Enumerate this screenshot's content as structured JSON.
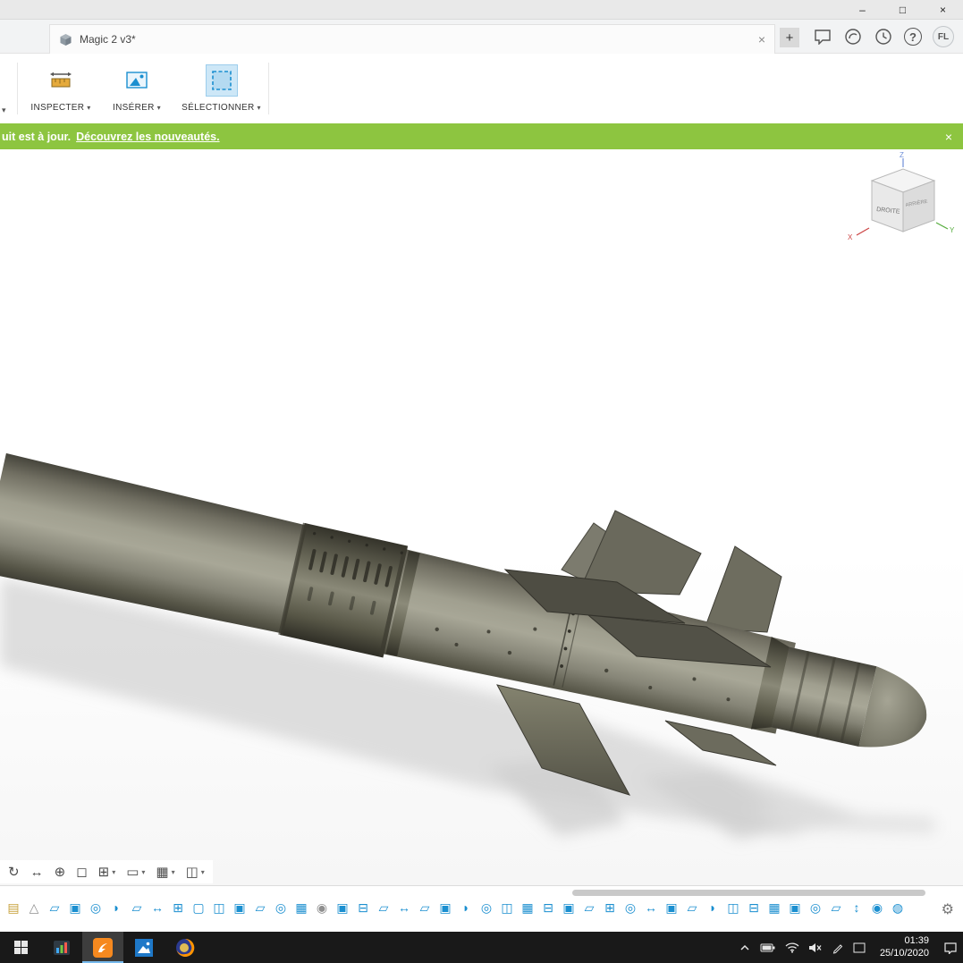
{
  "colors": {
    "accent-blue": "#0696d7",
    "banner-green": "#8dc540",
    "missile-body": "#8b8a7a",
    "timeline-icon-blue": "#1b8fd0",
    "taskbar-bg": "#191919"
  },
  "window": {
    "title_buttons": {
      "minimize": "–",
      "maximize": "□",
      "close": "×"
    }
  },
  "tabbar": {
    "document_tab": {
      "title": "Magic 2 v3*",
      "close_glyph": "×"
    },
    "new_tab_glyph": "+",
    "help_glyph": "?",
    "avatar_initials": "FL"
  },
  "toolbar": {
    "caret": "▾",
    "groups": [
      {
        "label": "INSPECTER",
        "icon": "measure-icon"
      },
      {
        "label": "INSÉRER",
        "icon": "insert-image-icon"
      },
      {
        "label": "SÉLECTIONNER",
        "icon": "select-box-icon",
        "active": true
      }
    ]
  },
  "banner": {
    "message": "uit est à jour.",
    "link_text": "Découvrez les nouveautés.",
    "close_glyph": "×"
  },
  "viewcube": {
    "face_front": "DROITE",
    "face_side": "ARRIÈRE",
    "axis_x": "X",
    "axis_y": "Y",
    "axis_z": "Z"
  },
  "navbar": {
    "items": [
      {
        "name": "orbit-tool",
        "glyph": "↻",
        "caret": false
      },
      {
        "name": "pan-tool",
        "glyph": "↔",
        "caret": false
      },
      {
        "name": "zoom-tool",
        "glyph": "⊕",
        "caret": false
      },
      {
        "name": "fit-view-tool",
        "glyph": "◻",
        "caret": false
      },
      {
        "name": "zoom-window-tool",
        "glyph": "⊞",
        "caret": true
      },
      {
        "name": "display-settings",
        "glyph": "▭",
        "caret": true
      },
      {
        "name": "grid-and-snaps",
        "glyph": "▦",
        "caret": true
      },
      {
        "name": "viewports",
        "glyph": "◫",
        "caret": true
      }
    ]
  },
  "timeline": {
    "gear_glyph": "⚙",
    "icons": [
      {
        "name": "canvas",
        "glyph": "▤",
        "color": "#c7a13b"
      },
      {
        "name": "mesh",
        "glyph": "△",
        "color": "#8f8f8f"
      },
      {
        "name": "sketch",
        "glyph": "▱",
        "color": "#1b8fd0"
      },
      {
        "name": "extrude",
        "glyph": "▣",
        "color": "#1b8fd0"
      },
      {
        "name": "hole",
        "glyph": "◎",
        "color": "#1b8fd0"
      },
      {
        "name": "fillet",
        "glyph": "◗",
        "color": "#1b8fd0"
      },
      {
        "name": "plane",
        "glyph": "▱",
        "color": "#1b8fd0"
      },
      {
        "name": "move",
        "glyph": "↔",
        "color": "#1b8fd0"
      },
      {
        "name": "combine",
        "glyph": "⊞",
        "color": "#1b8fd0"
      },
      {
        "name": "shell",
        "glyph": "▢",
        "color": "#1b8fd0"
      },
      {
        "name": "mirror",
        "glyph": "◫",
        "color": "#1b8fd0"
      },
      {
        "name": "extrude",
        "glyph": "▣",
        "color": "#1b8fd0"
      },
      {
        "name": "sketch",
        "glyph": "▱",
        "color": "#1b8fd0"
      },
      {
        "name": "hole",
        "glyph": "◎",
        "color": "#1b8fd0"
      },
      {
        "name": "pattern",
        "glyph": "▦",
        "color": "#1b8fd0"
      },
      {
        "name": "joint",
        "glyph": "◉",
        "color": "#8f8f8f"
      },
      {
        "name": "extrude",
        "glyph": "▣",
        "color": "#1b8fd0"
      },
      {
        "name": "cut",
        "glyph": "⊟",
        "color": "#1b8fd0"
      },
      {
        "name": "plane",
        "glyph": "▱",
        "color": "#1b8fd0"
      },
      {
        "name": "move",
        "glyph": "↔",
        "color": "#1b8fd0"
      },
      {
        "name": "sketch",
        "glyph": "▱",
        "color": "#1b8fd0"
      },
      {
        "name": "extrude",
        "glyph": "▣",
        "color": "#1b8fd0"
      },
      {
        "name": "fillet",
        "glyph": "◗",
        "color": "#1b8fd0"
      },
      {
        "name": "hole",
        "glyph": "◎",
        "color": "#1b8fd0"
      },
      {
        "name": "mirror",
        "glyph": "◫",
        "color": "#1b8fd0"
      },
      {
        "name": "pattern",
        "glyph": "▦",
        "color": "#1b8fd0"
      },
      {
        "name": "cut",
        "glyph": "⊟",
        "color": "#1b8fd0"
      },
      {
        "name": "extrude",
        "glyph": "▣",
        "color": "#1b8fd0"
      },
      {
        "name": "sketch",
        "glyph": "▱",
        "color": "#1b8fd0"
      },
      {
        "name": "combine",
        "glyph": "⊞",
        "color": "#1b8fd0"
      },
      {
        "name": "hole",
        "glyph": "◎",
        "color": "#1b8fd0"
      },
      {
        "name": "move",
        "glyph": "↔",
        "color": "#1b8fd0"
      },
      {
        "name": "extrude",
        "glyph": "▣",
        "color": "#1b8fd0"
      },
      {
        "name": "plane",
        "glyph": "▱",
        "color": "#1b8fd0"
      },
      {
        "name": "fillet",
        "glyph": "◗",
        "color": "#1b8fd0"
      },
      {
        "name": "mirror",
        "glyph": "◫",
        "color": "#1b8fd0"
      },
      {
        "name": "cut",
        "glyph": "⊟",
        "color": "#1b8fd0"
      },
      {
        "name": "pattern",
        "glyph": "▦",
        "color": "#1b8fd0"
      },
      {
        "name": "extrude",
        "glyph": "▣",
        "color": "#1b8fd0"
      },
      {
        "name": "hole",
        "glyph": "◎",
        "color": "#1b8fd0"
      },
      {
        "name": "sketch",
        "glyph": "▱",
        "color": "#1b8fd0"
      },
      {
        "name": "align",
        "glyph": "↕",
        "color": "#1b8fd0"
      },
      {
        "name": "joint",
        "glyph": "◉",
        "color": "#1b8fd0"
      },
      {
        "name": "appearance",
        "glyph": "◍",
        "color": "#1b8fd0"
      }
    ]
  },
  "taskbar": {
    "apps": [
      {
        "name": "media-app",
        "kind": "media",
        "active": false
      },
      {
        "name": "fusion-360",
        "kind": "fusion",
        "active": true
      },
      {
        "name": "photos-app",
        "kind": "photos",
        "active": false
      },
      {
        "name": "firefox",
        "kind": "firefox",
        "active": false
      }
    ],
    "tray": [
      "hidden-icons-chevron",
      "battery",
      "wifi",
      "volume-muted",
      "pen",
      "notification"
    ],
    "clock": {
      "time": "01:39",
      "date": "25/10/2020"
    }
  }
}
